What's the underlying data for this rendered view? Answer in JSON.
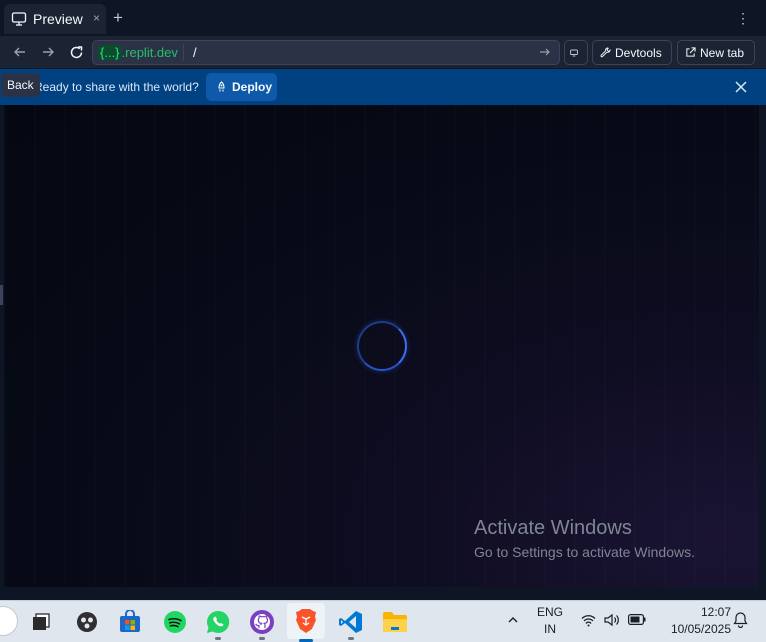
{
  "tab": {
    "title": "Preview",
    "close": "×",
    "new": "+"
  },
  "menu": {
    "kebab": "⋮"
  },
  "address": {
    "host_prefix": "{...}",
    "host_suffix": ".replit.dev",
    "path": "/"
  },
  "toolbar": {
    "devtools": "Devtools",
    "new_tab": "New tab"
  },
  "tooltip": {
    "back": "Back"
  },
  "banner": {
    "message": "Ready to share with the world?",
    "deploy": "Deploy"
  },
  "watermark": {
    "line1": "Activate Windows",
    "line2": "Go to Settings to activate Windows."
  },
  "taskbar": {
    "apps": [
      "file-explorer",
      "obs",
      "store",
      "spotify",
      "whatsapp",
      "github",
      "brave",
      "vscode",
      "folder"
    ],
    "lang": {
      "line1": "ENG",
      "line2": "IN"
    },
    "time": "12:07",
    "date": "10/05/2025"
  },
  "colors": {
    "accent": "#0079f2",
    "banner_bg": "#004182",
    "url_green": "#24c069"
  }
}
